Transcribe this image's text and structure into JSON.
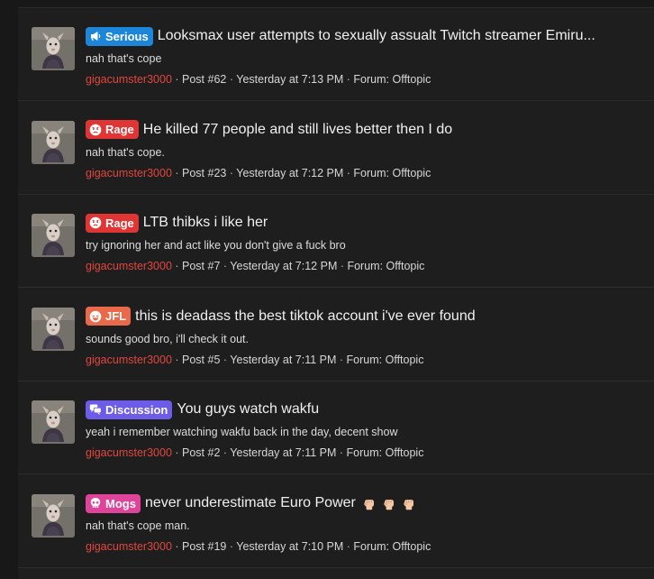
{
  "results": [
    {
      "badge": {
        "label": "Serious",
        "color": "#1d86d9",
        "icon": "megaphone-icon"
      },
      "title": "Looksmax user attempts to sexually assualt Twitch streamer Emiru...",
      "snippet": "nah that's cope",
      "username": "gigacumster3000",
      "post": "Post #62",
      "time": "Yesterday at 7:13 PM",
      "forum": "Forum: Offtopic"
    },
    {
      "badge": {
        "label": "Rage",
        "color": "#e03535",
        "icon": "angry-face-icon"
      },
      "title": "He killed 77 people and still lives better then I do",
      "snippet": "nah that's cope.",
      "username": "gigacumster3000",
      "post": "Post #23",
      "time": "Yesterday at 7:12 PM",
      "forum": "Forum: Offtopic"
    },
    {
      "badge": {
        "label": "Rage",
        "color": "#e03535",
        "icon": "angry-face-icon"
      },
      "title": "LTB thibks i like her",
      "snippet": "try ignoring her and act like you don't give a fuck bro",
      "username": "gigacumster3000",
      "post": "Post #7",
      "time": "Yesterday at 7:12 PM",
      "forum": "Forum: Offtopic"
    },
    {
      "badge": {
        "label": "JFL",
        "color": "#e86a4b",
        "icon": "laughing-face-icon"
      },
      "title": "this is deadass the best tiktok account i've ever found",
      "snippet": "sounds good bro, i'll check it out.",
      "username": "gigacumster3000",
      "post": "Post #5",
      "time": "Yesterday at 7:11 PM",
      "forum": "Forum: Offtopic"
    },
    {
      "badge": {
        "label": "Discussion",
        "color": "#6c5ce7",
        "icon": "chat-bubbles-icon"
      },
      "title": "You guys watch wakfu",
      "snippet": "yeah i remember watching wakfu back in the day, decent show",
      "username": "gigacumster3000",
      "post": "Post #2",
      "time": "Yesterday at 7:11 PM",
      "forum": "Forum: Offtopic"
    },
    {
      "badge": {
        "label": "Mogs",
        "color": "#e0449a",
        "icon": "skull-icon"
      },
      "title": "never underestimate Euro Power",
      "title_emoji": [
        "raised-fist-icon",
        "raised-fist-icon",
        "raised-fist-icon"
      ],
      "snippet": "nah that's cope man.",
      "username": "gigacumster3000",
      "post": "Post #19",
      "time": "Yesterday at 7:10 PM",
      "forum": "Forum: Offtopic"
    }
  ]
}
